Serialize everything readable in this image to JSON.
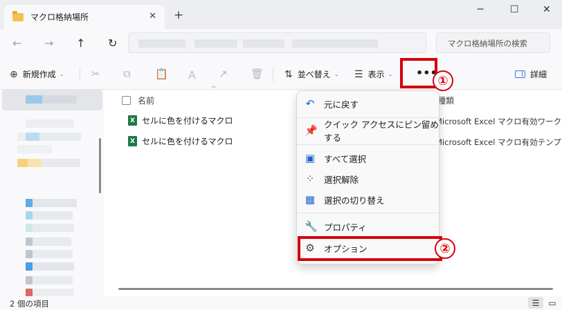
{
  "window": {
    "tab_title": "マクロ格納場所",
    "tab_close": "✕",
    "new_tab": "+",
    "minimize": "─",
    "maximize": "☐",
    "close": "✕"
  },
  "navigation": {
    "back": "←",
    "forward": "→",
    "up": "↑",
    "refresh": "↻"
  },
  "search": {
    "placeholder": "マクロ格納場所の検索"
  },
  "toolbar": {
    "new_label": "新規作成",
    "sort_label": "並べ替え",
    "view_label": "表示",
    "more_label": "•••",
    "details_label": "詳細"
  },
  "annotations": {
    "badge1": "①",
    "badge2": "②",
    "accent_color": "#d3000b"
  },
  "file_list": {
    "column_name": "名前",
    "column_type": "種類",
    "files": [
      {
        "name": "セルに色を付けるマクロ",
        "type": "Microsoft Excel マクロ有効ワークシート"
      },
      {
        "name": "セルに色を付けるマクロ",
        "type": "Microsoft Excel マクロ有効テンプレート"
      }
    ]
  },
  "context_menu": {
    "items": [
      {
        "label": "元に戻す",
        "icon": "undo-icon"
      },
      {
        "label": "クイック アクセスにピン留めする",
        "icon": "pin-icon"
      },
      {
        "label": "すべて選択",
        "icon": "select-all-icon"
      },
      {
        "label": "選択解除",
        "icon": "select-none-icon"
      },
      {
        "label": "選択の切り替え",
        "icon": "invert-selection-icon"
      },
      {
        "label": "プロパティ",
        "icon": "wrench-icon"
      },
      {
        "label": "オプション",
        "icon": "gear-icon"
      }
    ]
  },
  "status": {
    "item_count": "2 個の項目"
  }
}
